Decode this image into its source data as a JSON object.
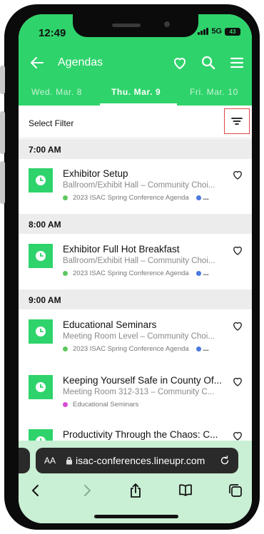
{
  "status": {
    "time": "12:49",
    "network": "5G",
    "battery": "43"
  },
  "header": {
    "title": "Agendas"
  },
  "tabs": [
    {
      "label": "Wed. Mar. 8",
      "active": false
    },
    {
      "label": "Thu. Mar. 9",
      "active": true
    },
    {
      "label": "Fri. Mar. 10",
      "active": false
    }
  ],
  "filter": {
    "label": "Select Filter"
  },
  "time_slots": [
    "7:00 AM",
    "8:00 AM",
    "9:00 AM"
  ],
  "sessions": [
    {
      "title": "Exhibitor Setup",
      "location": "Ballroom/Exhibit Hall – Community Choi...",
      "tag": "2023 ISAC Spring Conference Agenda",
      "more": "...",
      "tag_color": "#5ec85e"
    },
    {
      "title": "Exhibitor Full Hot Breakfast",
      "location": "Ballroom/Exhibit Hall – Community Choi...",
      "tag": "2023 ISAC Spring Conference Agenda",
      "more": "...",
      "tag_color": "#5ec85e"
    },
    {
      "title": "Educational Seminars",
      "location": "Meeting Room Level – Community Choi...",
      "tag": "2023 ISAC Spring Conference Agenda",
      "more": "...",
      "tag_color": "#5ec85e"
    },
    {
      "title": "Keeping Yourself Safe in County Of...",
      "location": "Meeting Room 312-313 – Community C...",
      "tag": "Educational Seminars",
      "tag_color": "#d94ad6"
    },
    {
      "title": "Productivity Through the Chaos: C...",
      "location": "",
      "tag": ""
    }
  ],
  "browser": {
    "aa": "AA",
    "url": "isac-conferences.lineupr.com"
  },
  "colors": {
    "brand_green": "#2fd36b",
    "second_tag_dot": "#4a78e0",
    "filter_highlight": "#e04848"
  },
  "icons": [
    "back-arrow-icon",
    "heart-icon",
    "search-icon",
    "menu-icon",
    "filter-icon",
    "clock-icon",
    "lock-icon",
    "reload-icon",
    "back-icon",
    "forward-icon",
    "share-icon",
    "bookmarks-icon",
    "tabs-icon"
  ]
}
